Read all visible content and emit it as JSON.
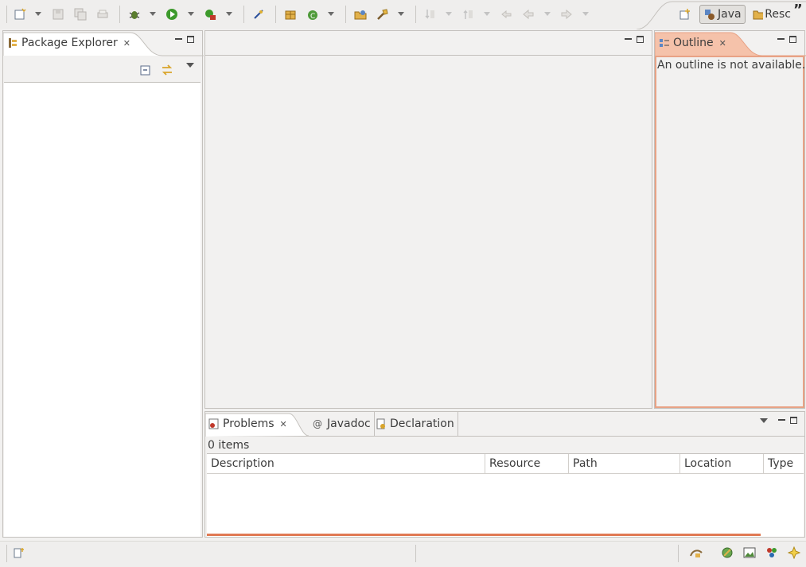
{
  "toolbar": {
    "icons": [
      "new-wizard-icon",
      "save-icon",
      "save-all-icon",
      "print-icon",
      "debug-icon",
      "run-icon",
      "external-tools-icon",
      "toggle-mark-occurrences-icon",
      "new-java-package-icon",
      "new-java-class-icon",
      "open-type-icon",
      "search-icon",
      "next-annotation-icon",
      "previous-annotation-icon",
      "last-edit-location-icon",
      "back-icon",
      "forward-icon"
    ]
  },
  "perspectives": {
    "java": "Java",
    "resource": "Resc",
    "more": "”"
  },
  "package_explorer": {
    "title": "Package Explorer"
  },
  "outline": {
    "title": "Outline",
    "message": "An outline is not available."
  },
  "bottom_panel": {
    "tabs": [
      "Problems",
      "Javadoc",
      "Declaration"
    ],
    "items_count": "0 items",
    "columns": [
      "Description",
      "Resource",
      "Path",
      "Location",
      "Type"
    ]
  },
  "colors": {
    "accent": "#e8a285",
    "background": "#f2f1f0",
    "progress": "#e07a54"
  }
}
